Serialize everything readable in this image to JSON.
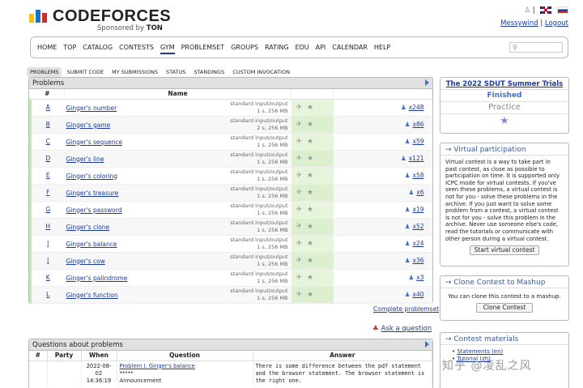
{
  "logo": {
    "text": "CODEFORCES",
    "sponsored_prefix": "Sponsored by",
    "sponsor": "TON"
  },
  "topright": {
    "separator": "|",
    "username": "Messywind",
    "logout": "Logout"
  },
  "nav": [
    "HOME",
    "TOP",
    "CATALOG",
    "CONTESTS",
    "GYM",
    "PROBLEMSET",
    "GROUPS",
    "RATING",
    "EDU",
    "API",
    "CALENDAR",
    "HELP"
  ],
  "nav_active": "GYM",
  "subnav": [
    "PROBLEMS",
    "SUBMIT CODE",
    "MY SUBMISSIONS",
    "STATUS",
    "STANDINGS",
    "CUSTOM INVOCATION"
  ],
  "problems": {
    "title": "Problems",
    "headers": [
      "#",
      "Name"
    ],
    "rows": [
      {
        "id": "A",
        "name": "Ginger's number",
        "io": "standard input/output",
        "limits": "1 s, 256 MB",
        "count": "x248"
      },
      {
        "id": "B",
        "name": "Ginger's game",
        "io": "standard input/output",
        "limits": "2 s, 256 MB",
        "count": "x86"
      },
      {
        "id": "C",
        "name": "Ginger's sequence",
        "io": "standard input/output",
        "limits": "1 s, 256 MB",
        "count": "x59"
      },
      {
        "id": "D",
        "name": "Ginger's line",
        "io": "standard input/output",
        "limits": "1 s, 256 MB",
        "count": "x121"
      },
      {
        "id": "E",
        "name": "Ginger's coloring",
        "io": "standard input/output",
        "limits": "1 s, 256 MB",
        "count": "x58"
      },
      {
        "id": "F",
        "name": "Ginger's treasure",
        "io": "standard input/output",
        "limits": "1 s, 256 MB",
        "count": "x6"
      },
      {
        "id": "G",
        "name": "Ginger's password",
        "io": "standard input/output",
        "limits": "1 s, 256 MB",
        "count": "x19"
      },
      {
        "id": "H",
        "name": "Ginger's clone",
        "io": "standard input/output",
        "limits": "1 s, 256 MB",
        "count": "x52"
      },
      {
        "id": "I",
        "name": "Ginger's balance",
        "io": "standard input/output",
        "limits": "1 s, 256 MB",
        "count": "x24"
      },
      {
        "id": "J",
        "name": "Ginger's cow",
        "io": "standard input/output",
        "limits": "1 s, 256 MB",
        "count": "x36"
      },
      {
        "id": "K",
        "name": "Ginger's palindrome",
        "io": "standard input/output",
        "limits": "1 s, 256 MB",
        "count": "x3"
      },
      {
        "id": "L",
        "name": "Ginger's function",
        "io": "standard input/output",
        "limits": "1 s, 256 MB",
        "count": "x40"
      }
    ],
    "complete_link": "Complete problemset"
  },
  "ask_question": "Ask a question",
  "questions": {
    "title": "Questions about problems",
    "headers": [
      "#",
      "Party",
      "When",
      "Question",
      "Answer"
    ],
    "rows": [
      {
        "num": "",
        "party": "",
        "when": "2022-08-02 14:36:19",
        "question_link": "Problem I. Ginger's balance",
        "question_text": "*****",
        "question_type": "Announcement",
        "answer": "There is some difference between the pdf statement and the browser statement. The browser statement is the right one."
      }
    ]
  },
  "contest": {
    "title": "The 2022 SDUT Summer Trials",
    "status": "Finished",
    "mode": "Practice"
  },
  "virtual": {
    "title": "→ Virtual participation",
    "text": "Virtual contest is a way to take part in past contest, as close as possible to participation on time. It is supported only ICPC mode for virtual contests. If you've seen these problems, a virtual contest is not for you - solve these problems in the archive. If you just want to solve some problem from a contest, a virtual contest is not for you - solve this problem in the archive. Never use someone else's code, read the tutorials or communicate with other person during a virtual contest.",
    "button": "Start virtual contest"
  },
  "clone": {
    "title": "→ Clone Contest to Mashup",
    "text": "You can clone this contest to a mashup.",
    "button": "Clone Contest"
  },
  "materials": {
    "title": "→ Contest materials",
    "items": [
      "Statements (en)",
      "Tutorial (zh)"
    ]
  },
  "watermark": "知乎 @凌乱之风",
  "colors": {
    "accent": "#1a3aa0",
    "status_blue": "#3b6fd6",
    "accepted_green": "#c6e7b5"
  }
}
